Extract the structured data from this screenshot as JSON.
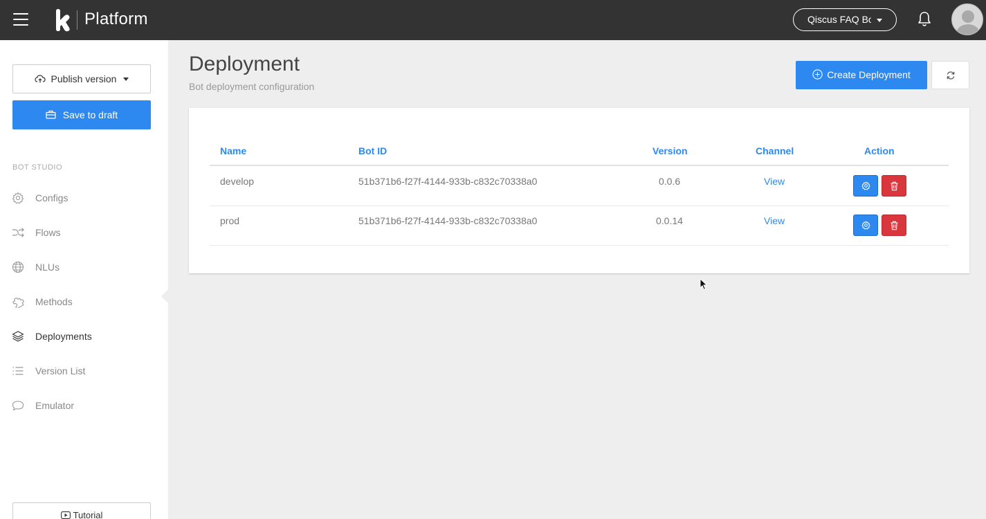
{
  "header": {
    "brand": "Platform",
    "bot_selector": "Qiscus FAQ Bot"
  },
  "sidebar": {
    "publish_label": "Publish version",
    "save_draft_label": "Save to draft",
    "section_label": "BOT STUDIO",
    "items": [
      {
        "label": "Configs",
        "icon": "gear-icon"
      },
      {
        "label": "Flows",
        "icon": "shuffle-icon"
      },
      {
        "label": "NLUs",
        "icon": "globe-icon"
      },
      {
        "label": "Methods",
        "icon": "puzzle-icon"
      },
      {
        "label": "Deployments",
        "icon": "layers-icon",
        "active": true
      },
      {
        "label": "Version List",
        "icon": "list-icon"
      },
      {
        "label": "Emulator",
        "icon": "chat-bubble-icon"
      }
    ],
    "tutorial_label": "Tutorial"
  },
  "main": {
    "title": "Deployment",
    "subtitle": "Bot deployment configuration",
    "create_label": "Create Deployment",
    "table": {
      "headers": [
        "Name",
        "Bot ID",
        "Version",
        "Channel",
        "Action"
      ],
      "rows": [
        {
          "name": "develop",
          "bot_id": "51b371b6-f27f-4144-933b-c832c70338a0",
          "version": "0.0.6",
          "channel": "View"
        },
        {
          "name": "prod",
          "bot_id": "51b371b6-f27f-4144-933b-c832c70338a0",
          "version": "0.0.14",
          "channel": "View"
        }
      ]
    }
  },
  "colors": {
    "topbar": "#333333",
    "primary": "#2d89ef",
    "danger": "#d9363e",
    "background": "#eeeeee"
  }
}
